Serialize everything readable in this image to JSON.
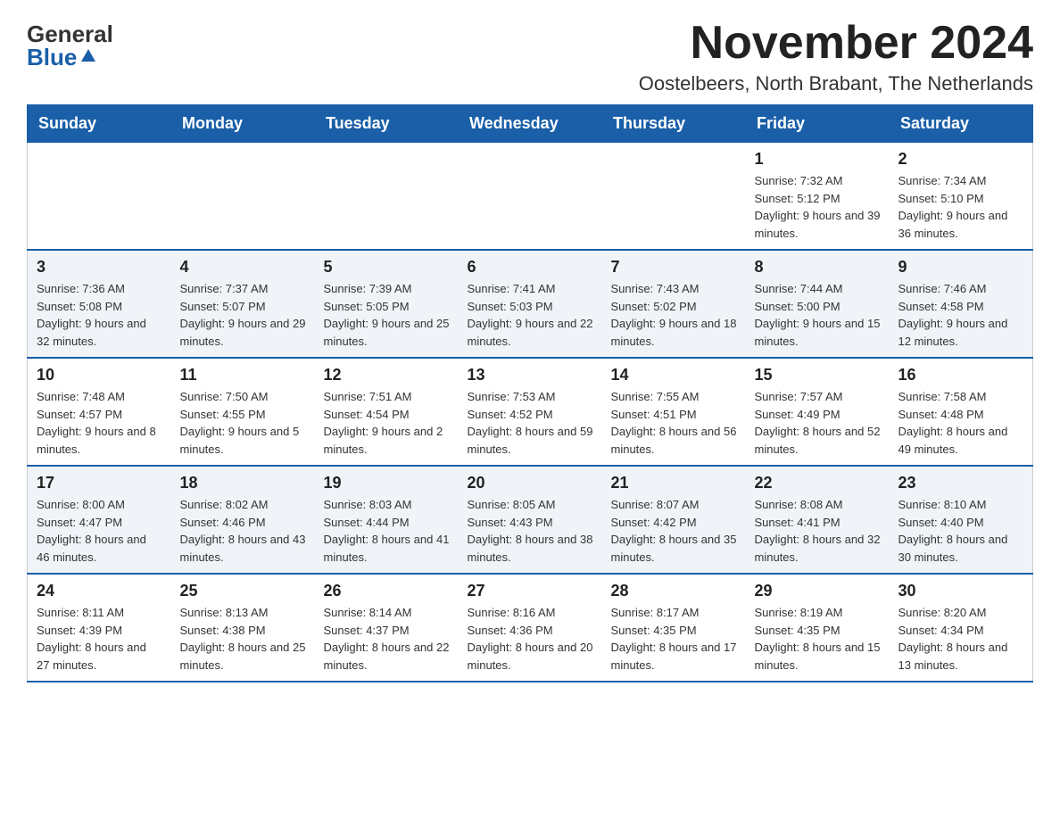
{
  "logo": {
    "general": "General",
    "blue": "Blue"
  },
  "header": {
    "month_year": "November 2024",
    "location": "Oostelbeers, North Brabant, The Netherlands"
  },
  "weekdays": [
    "Sunday",
    "Monday",
    "Tuesday",
    "Wednesday",
    "Thursday",
    "Friday",
    "Saturday"
  ],
  "weeks": [
    [
      {
        "day": "",
        "info": ""
      },
      {
        "day": "",
        "info": ""
      },
      {
        "day": "",
        "info": ""
      },
      {
        "day": "",
        "info": ""
      },
      {
        "day": "",
        "info": ""
      },
      {
        "day": "1",
        "info": "Sunrise: 7:32 AM\nSunset: 5:12 PM\nDaylight: 9 hours and 39 minutes."
      },
      {
        "day": "2",
        "info": "Sunrise: 7:34 AM\nSunset: 5:10 PM\nDaylight: 9 hours and 36 minutes."
      }
    ],
    [
      {
        "day": "3",
        "info": "Sunrise: 7:36 AM\nSunset: 5:08 PM\nDaylight: 9 hours and 32 minutes."
      },
      {
        "day": "4",
        "info": "Sunrise: 7:37 AM\nSunset: 5:07 PM\nDaylight: 9 hours and 29 minutes."
      },
      {
        "day": "5",
        "info": "Sunrise: 7:39 AM\nSunset: 5:05 PM\nDaylight: 9 hours and 25 minutes."
      },
      {
        "day": "6",
        "info": "Sunrise: 7:41 AM\nSunset: 5:03 PM\nDaylight: 9 hours and 22 minutes."
      },
      {
        "day": "7",
        "info": "Sunrise: 7:43 AM\nSunset: 5:02 PM\nDaylight: 9 hours and 18 minutes."
      },
      {
        "day": "8",
        "info": "Sunrise: 7:44 AM\nSunset: 5:00 PM\nDaylight: 9 hours and 15 minutes."
      },
      {
        "day": "9",
        "info": "Sunrise: 7:46 AM\nSunset: 4:58 PM\nDaylight: 9 hours and 12 minutes."
      }
    ],
    [
      {
        "day": "10",
        "info": "Sunrise: 7:48 AM\nSunset: 4:57 PM\nDaylight: 9 hours and 8 minutes."
      },
      {
        "day": "11",
        "info": "Sunrise: 7:50 AM\nSunset: 4:55 PM\nDaylight: 9 hours and 5 minutes."
      },
      {
        "day": "12",
        "info": "Sunrise: 7:51 AM\nSunset: 4:54 PM\nDaylight: 9 hours and 2 minutes."
      },
      {
        "day": "13",
        "info": "Sunrise: 7:53 AM\nSunset: 4:52 PM\nDaylight: 8 hours and 59 minutes."
      },
      {
        "day": "14",
        "info": "Sunrise: 7:55 AM\nSunset: 4:51 PM\nDaylight: 8 hours and 56 minutes."
      },
      {
        "day": "15",
        "info": "Sunrise: 7:57 AM\nSunset: 4:49 PM\nDaylight: 8 hours and 52 minutes."
      },
      {
        "day": "16",
        "info": "Sunrise: 7:58 AM\nSunset: 4:48 PM\nDaylight: 8 hours and 49 minutes."
      }
    ],
    [
      {
        "day": "17",
        "info": "Sunrise: 8:00 AM\nSunset: 4:47 PM\nDaylight: 8 hours and 46 minutes."
      },
      {
        "day": "18",
        "info": "Sunrise: 8:02 AM\nSunset: 4:46 PM\nDaylight: 8 hours and 43 minutes."
      },
      {
        "day": "19",
        "info": "Sunrise: 8:03 AM\nSunset: 4:44 PM\nDaylight: 8 hours and 41 minutes."
      },
      {
        "day": "20",
        "info": "Sunrise: 8:05 AM\nSunset: 4:43 PM\nDaylight: 8 hours and 38 minutes."
      },
      {
        "day": "21",
        "info": "Sunrise: 8:07 AM\nSunset: 4:42 PM\nDaylight: 8 hours and 35 minutes."
      },
      {
        "day": "22",
        "info": "Sunrise: 8:08 AM\nSunset: 4:41 PM\nDaylight: 8 hours and 32 minutes."
      },
      {
        "day": "23",
        "info": "Sunrise: 8:10 AM\nSunset: 4:40 PM\nDaylight: 8 hours and 30 minutes."
      }
    ],
    [
      {
        "day": "24",
        "info": "Sunrise: 8:11 AM\nSunset: 4:39 PM\nDaylight: 8 hours and 27 minutes."
      },
      {
        "day": "25",
        "info": "Sunrise: 8:13 AM\nSunset: 4:38 PM\nDaylight: 8 hours and 25 minutes."
      },
      {
        "day": "26",
        "info": "Sunrise: 8:14 AM\nSunset: 4:37 PM\nDaylight: 8 hours and 22 minutes."
      },
      {
        "day": "27",
        "info": "Sunrise: 8:16 AM\nSunset: 4:36 PM\nDaylight: 8 hours and 20 minutes."
      },
      {
        "day": "28",
        "info": "Sunrise: 8:17 AM\nSunset: 4:35 PM\nDaylight: 8 hours and 17 minutes."
      },
      {
        "day": "29",
        "info": "Sunrise: 8:19 AM\nSunset: 4:35 PM\nDaylight: 8 hours and 15 minutes."
      },
      {
        "day": "30",
        "info": "Sunrise: 8:20 AM\nSunset: 4:34 PM\nDaylight: 8 hours and 13 minutes."
      }
    ]
  ],
  "colors": {
    "header_bg": "#1a5fa8",
    "header_text": "#ffffff",
    "border": "#1a5fa8"
  }
}
